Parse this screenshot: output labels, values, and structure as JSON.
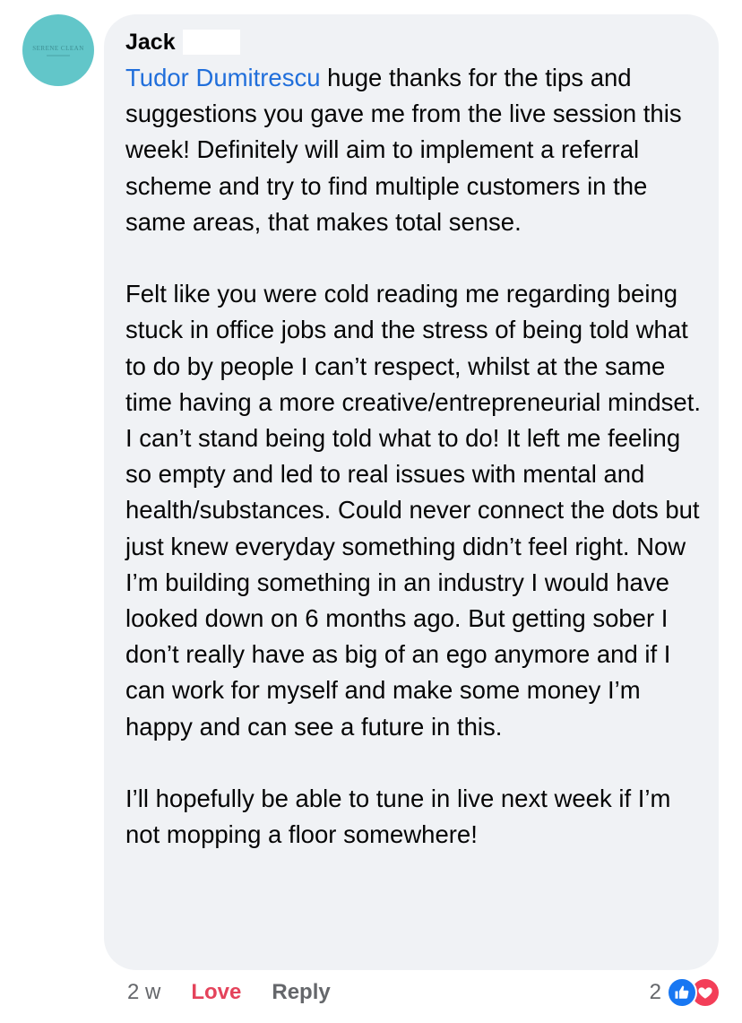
{
  "comment": {
    "author": {
      "name": "Jack",
      "avatar_text": "SERENE CLEAN"
    },
    "mention": "Tudor Dumitrescu",
    "paragraphs": [
      " huge thanks for the tips and suggestions you gave me from the live session this week! Definitely will aim to implement a referral scheme and try to find multiple customers in the same areas, that makes total sense.",
      "Felt like you were cold reading me regarding being stuck in office jobs and the stress of being told what to do by people I can’t respect, whilst at the same time having a more creative/entrepreneurial mindset. I can’t stand being told what to do! It left me feeling so empty and led to real issues with mental and health/substances. Could never connect the dots but just knew everyday something didn’t feel right. Now I’m building something in an industry I would have looked down on 6 months ago. But getting sober I don’t really have as big of an ego anymore and if I can work for myself and make some money I’m happy and can see a future in this.",
      "I’ll hopefully be able to tune in live next week if I’m not mopping a floor somewhere!"
    ],
    "timestamp": "2 w",
    "love_label": "Love",
    "reply_label": "Reply",
    "reaction_count": "2",
    "reactions": [
      "like-icon",
      "love-icon"
    ]
  },
  "colors": {
    "bubble_bg": "#f0f2f5",
    "mention": "#216fdb",
    "love": "#e4435b",
    "like_blue": "#1877f2",
    "love_red": "#f33e58",
    "avatar_bg": "#62c6c9"
  }
}
